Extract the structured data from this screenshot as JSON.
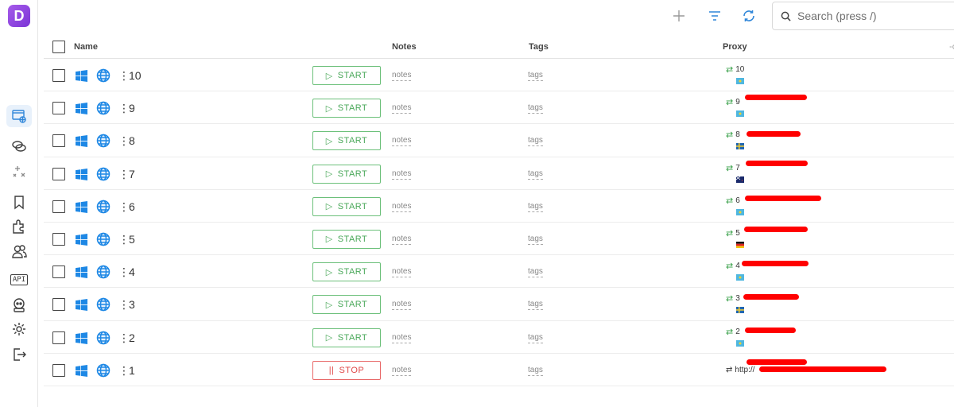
{
  "app": {
    "logo_letter": "D"
  },
  "sidebar": {
    "items": [
      {
        "name": "browser-profiles-icon",
        "active": true
      },
      {
        "name": "links-icon"
      },
      {
        "name": "sparkle-icon"
      },
      {
        "name": "bookmark-icon"
      },
      {
        "name": "extensions-icon"
      },
      {
        "name": "users-icon"
      },
      {
        "name": "api-icon",
        "label": "API"
      },
      {
        "name": "robot-icon"
      },
      {
        "name": "settings-icon"
      },
      {
        "name": "logout-icon"
      }
    ]
  },
  "topbar": {
    "search_placeholder": "Search (press /)"
  },
  "table": {
    "columns": {
      "name": "Name",
      "notes": "Notes",
      "tags": "Tags",
      "proxy": "Proxy"
    },
    "rows": [
      {
        "name": "10",
        "action": "START",
        "notes": "notes",
        "tags": "tags",
        "proxy": "10",
        "flag": "kazakhstan"
      },
      {
        "name": "9",
        "action": "START",
        "notes": "notes",
        "tags": "tags",
        "proxy": "9",
        "flag": "kazakhstan"
      },
      {
        "name": "8",
        "action": "START",
        "notes": "notes",
        "tags": "tags",
        "proxy": "8",
        "flag": "sweden"
      },
      {
        "name": "7",
        "action": "START",
        "notes": "notes",
        "tags": "tags",
        "proxy": "7",
        "flag": "new-zealand"
      },
      {
        "name": "6",
        "action": "START",
        "notes": "notes",
        "tags": "tags",
        "proxy": "6",
        "flag": "kazakhstan"
      },
      {
        "name": "5",
        "action": "START",
        "notes": "notes",
        "tags": "tags",
        "proxy": "5",
        "flag": "germany"
      },
      {
        "name": "4",
        "action": "START",
        "notes": "notes",
        "tags": "tags",
        "proxy": "4",
        "flag": "kazakhstan"
      },
      {
        "name": "3",
        "action": "START",
        "notes": "notes",
        "tags": "tags",
        "proxy": "3",
        "flag": "sweden"
      },
      {
        "name": "2",
        "action": "START",
        "notes": "notes",
        "tags": "tags",
        "proxy": "2",
        "flag": "kazakhstan"
      },
      {
        "name": "1",
        "action": "STOP",
        "notes": "notes",
        "tags": "tags",
        "proxy": "http://"
      }
    ]
  },
  "colors": {
    "start": "#4aa85a",
    "stop": "#e04848",
    "accent": "#2f86d9",
    "redaction": "#ff0000"
  }
}
